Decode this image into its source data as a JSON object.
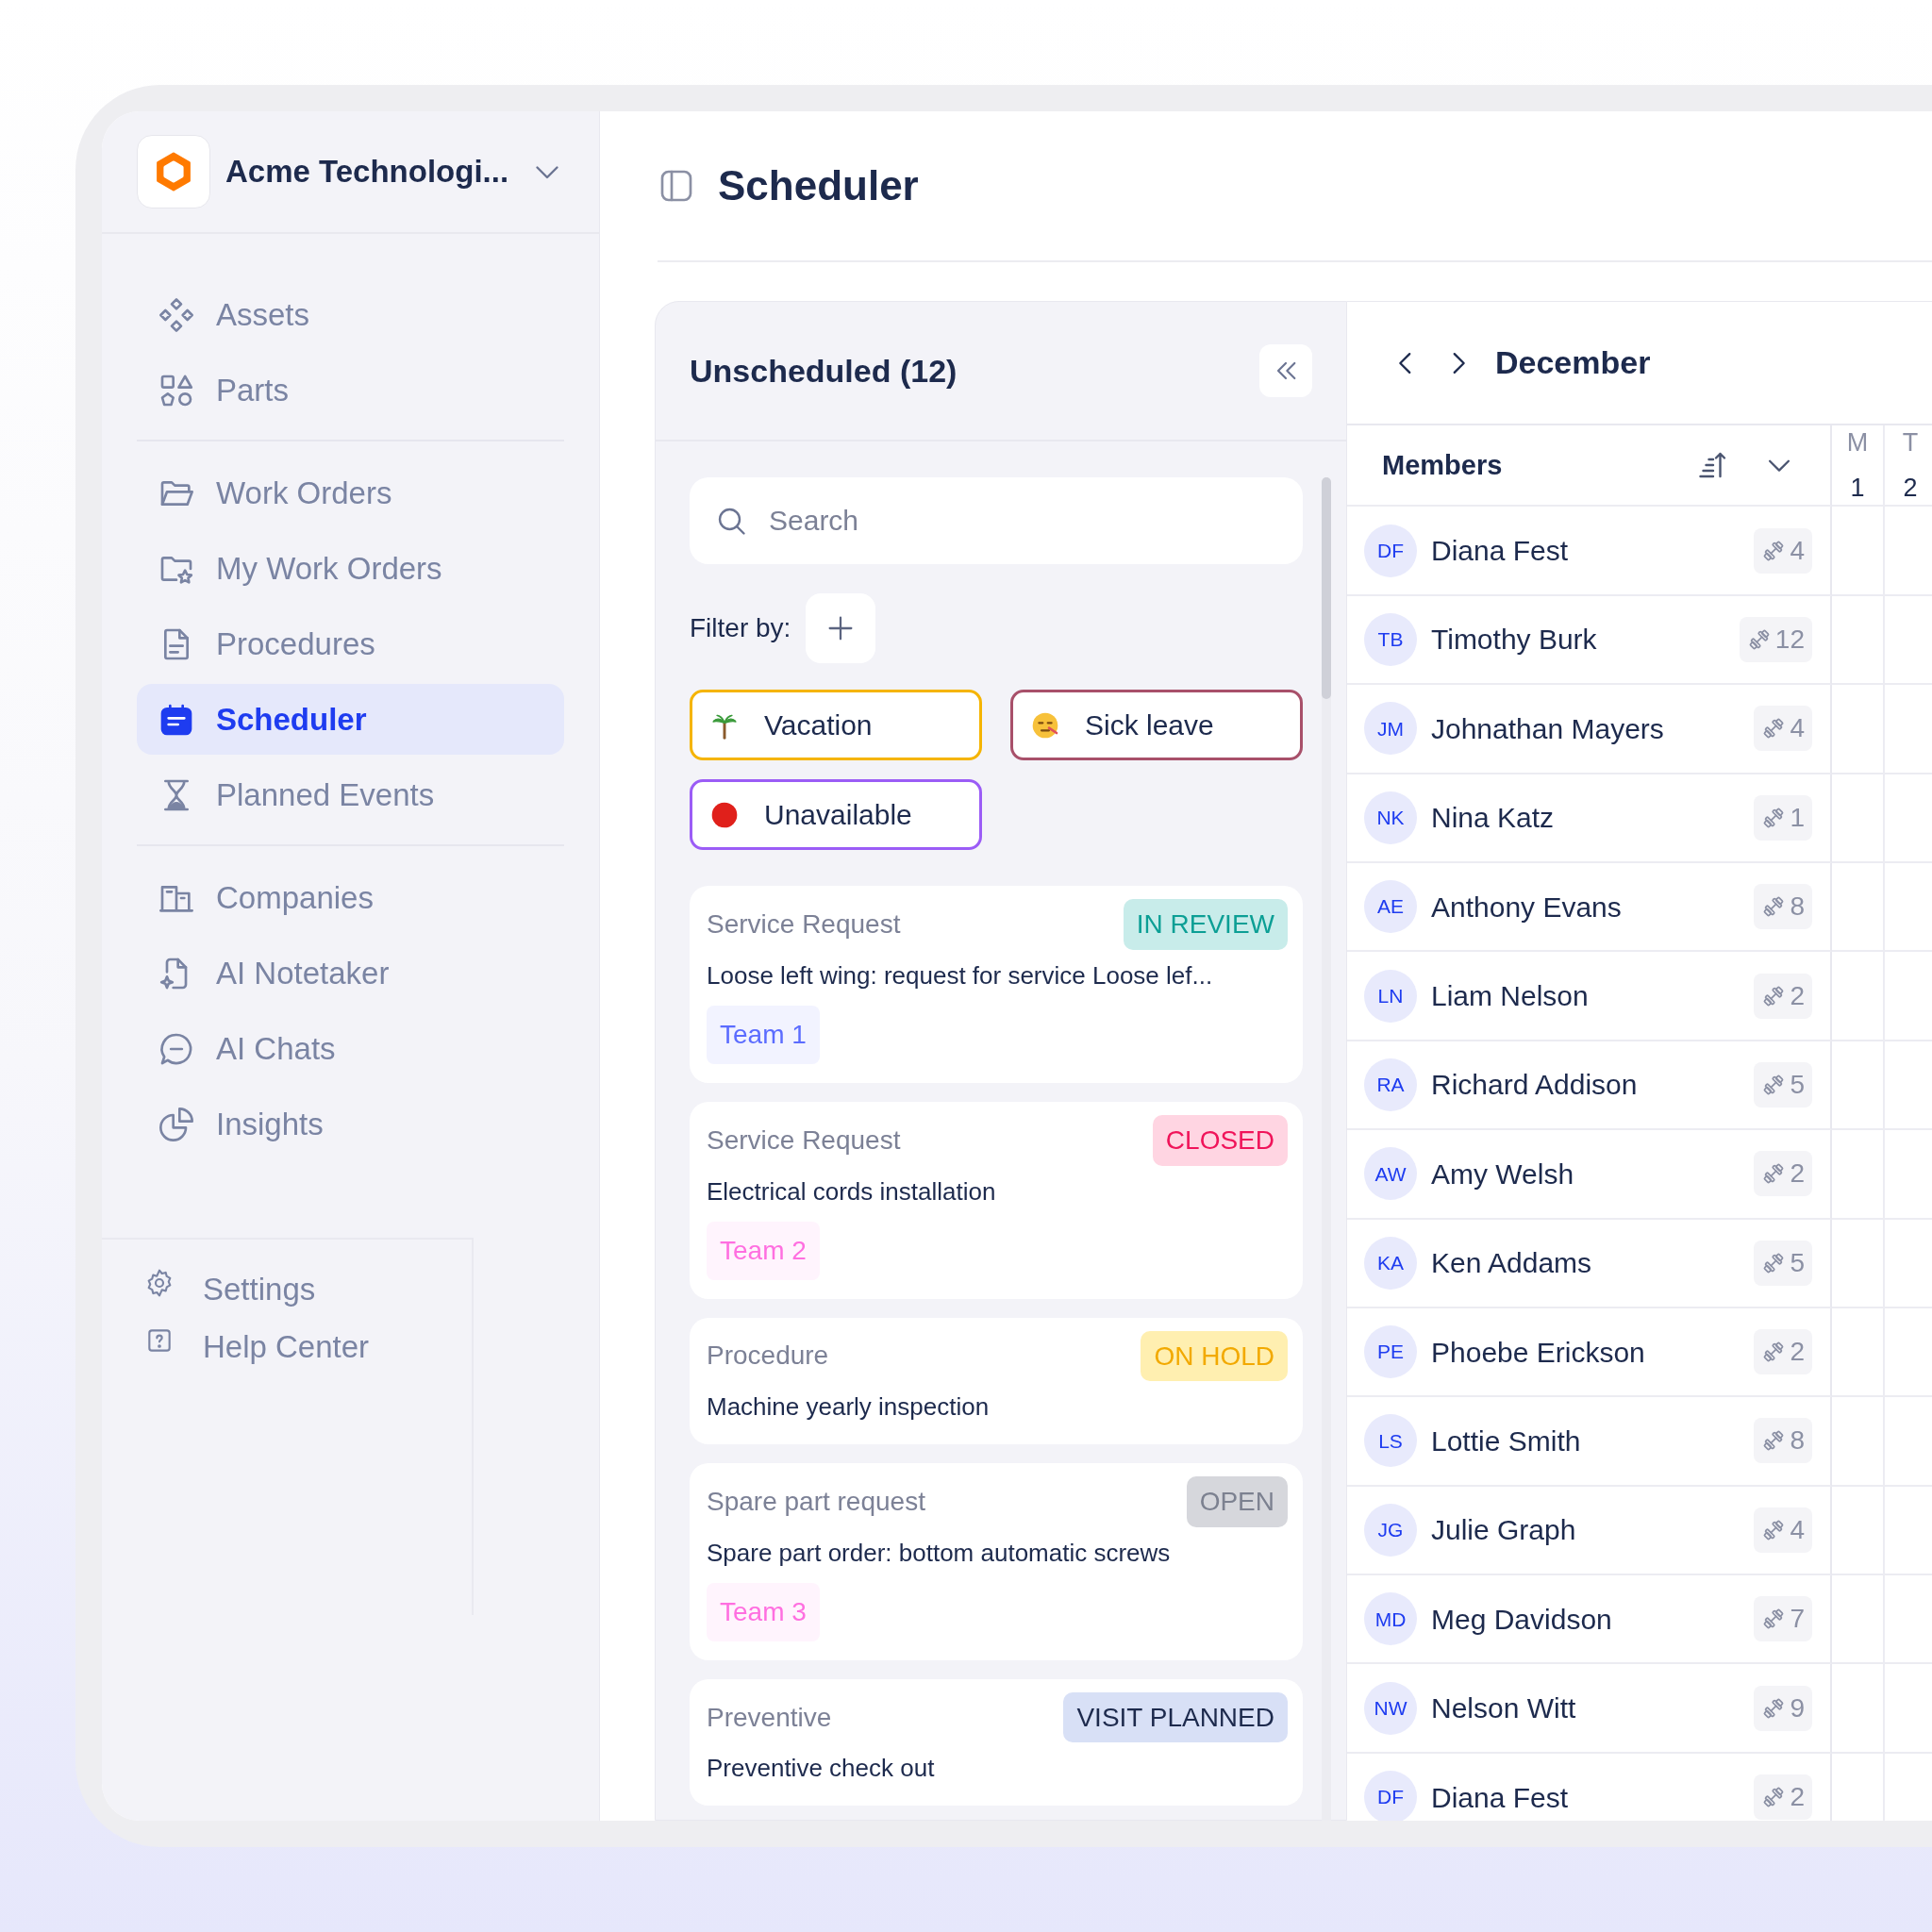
{
  "sidebar": {
    "company": "Acme Technologi...",
    "sections": [
      [
        {
          "label": "Assets",
          "selected": false
        },
        {
          "label": "Parts",
          "selected": false
        }
      ],
      [
        {
          "label": "Work Orders",
          "selected": false
        },
        {
          "label": "My Work Orders",
          "selected": false
        },
        {
          "label": "Procedures",
          "selected": false
        },
        {
          "label": "Scheduler",
          "selected": true
        },
        {
          "label": "Planned Events",
          "selected": false
        }
      ],
      [
        {
          "label": "Companies",
          "selected": false
        },
        {
          "label": "AI Notetaker",
          "selected": false
        },
        {
          "label": "AI Chats",
          "selected": false
        },
        {
          "label": "Insights",
          "selected": false
        }
      ]
    ],
    "footer": [
      {
        "label": "Settings"
      },
      {
        "label": "Help Center"
      }
    ]
  },
  "header": {
    "title": "Scheduler"
  },
  "unscheduled": {
    "title": "Unscheduled (12)",
    "search": {
      "placeholder": "Search"
    },
    "filter_label": "Filter by:",
    "chips": [
      {
        "label": "Vacation",
        "color": "#f5b400"
      },
      {
        "label": "Sick leave",
        "color": "#a8506a"
      },
      {
        "label": "Unavailable",
        "color": "#9b5cf6"
      }
    ],
    "cards": [
      {
        "type": "Service Request",
        "status": "IN REVIEW",
        "kind": "review",
        "title": "Loose left wing: request for service Loose lef...",
        "team": {
          "label": "Team 1",
          "color": "#5b6cff"
        }
      },
      {
        "type": "Service Request",
        "status": "CLOSED",
        "kind": "closed",
        "title": "Electrical cords installation",
        "team": {
          "label": "Team 2",
          "color": "#ff6fe0"
        }
      },
      {
        "type": "Procedure",
        "status": "ON HOLD",
        "kind": "hold",
        "title": "Machine yearly inspection"
      },
      {
        "type": "Spare part request",
        "status": "OPEN",
        "kind": "open",
        "title": "Spare part order: bottom automatic screws",
        "team": {
          "label": "Team 3",
          "color": "#ff6fe0"
        }
      },
      {
        "type": "Preventive",
        "status": "VISIT PLANNED",
        "kind": "planned",
        "title": "Preventive check out"
      }
    ]
  },
  "calendar": {
    "month": "December",
    "members_label": "Members",
    "days": [
      {
        "weekday": "M",
        "day": "1"
      },
      {
        "weekday": "T",
        "day": "2"
      }
    ],
    "members": [
      {
        "initials": "DF",
        "name": "Diana Fest",
        "count": "4"
      },
      {
        "initials": "TB",
        "name": "Timothy Burk",
        "count": "12"
      },
      {
        "initials": "JM",
        "name": "Johnathan Mayers",
        "count": "4"
      },
      {
        "initials": "NK",
        "name": "Nina Katz",
        "count": "1"
      },
      {
        "initials": "AE",
        "name": "Anthony Evans",
        "count": "8"
      },
      {
        "initials": "LN",
        "name": "Liam Nelson",
        "count": "2"
      },
      {
        "initials": "RA",
        "name": "Richard Addison",
        "count": "5"
      },
      {
        "initials": "AW",
        "name": "Amy Welsh",
        "count": "2"
      },
      {
        "initials": "KA",
        "name": "Ken Addams",
        "count": "5"
      },
      {
        "initials": "PE",
        "name": "Phoebe Erickson",
        "count": "2"
      },
      {
        "initials": "LS",
        "name": "Lottie Smith",
        "count": "8"
      },
      {
        "initials": "JG",
        "name": "Julie Graph",
        "count": "4"
      },
      {
        "initials": "MD",
        "name": "Meg Davidson",
        "count": "7"
      },
      {
        "initials": "NW",
        "name": "Nelson Witt",
        "count": "9"
      },
      {
        "initials": "DF",
        "name": "Diana Fest",
        "count": "2"
      }
    ]
  }
}
